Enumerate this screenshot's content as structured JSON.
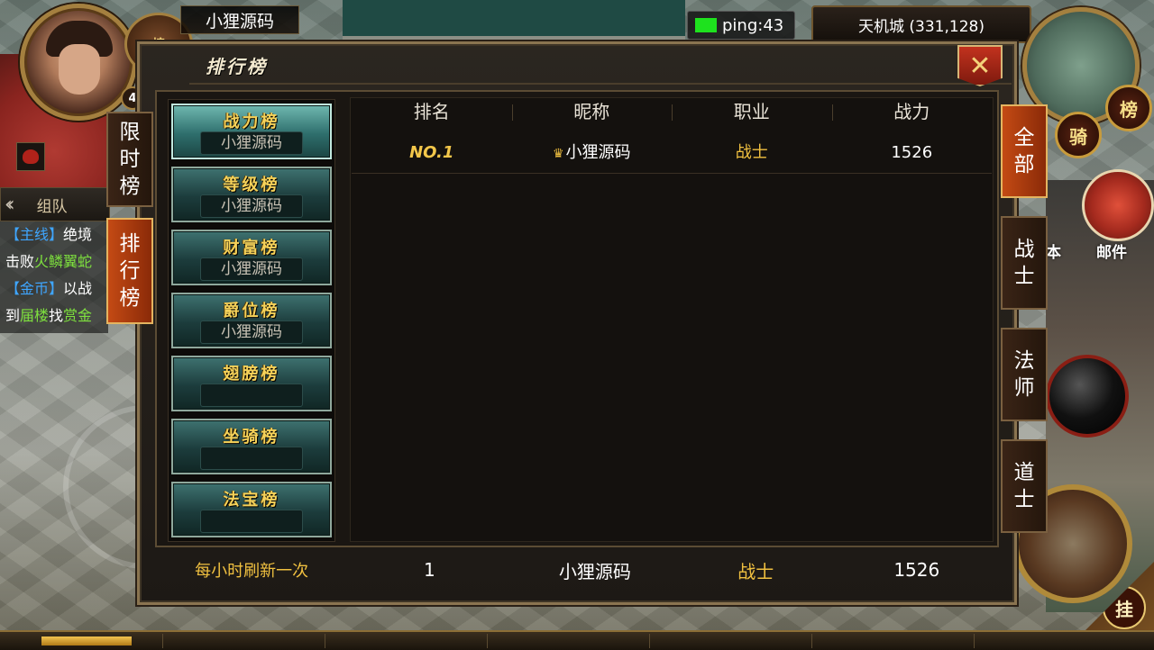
{
  "hud": {
    "player_name": "小狸源码",
    "level": "4",
    "shop_label": "榜",
    "ping_text": "ping:43",
    "location": "天机城 (331,128)",
    "ride_label": "骑",
    "rank_label": "榜",
    "mail_label": "邮件",
    "instance_label": "本",
    "hang_label": "挂",
    "colors": {
      "ping_ok": "#1ee21e",
      "accent_gold": "#f0c040",
      "active_tab": "#c44a14"
    }
  },
  "left_tabs": [
    {
      "label": "限时榜",
      "chars": [
        "限",
        "时",
        "榜"
      ],
      "active": false
    },
    {
      "label": "排行榜",
      "chars": [
        "排",
        "行",
        "榜"
      ],
      "active": true
    }
  ],
  "team": {
    "label": "组队",
    "collapse_icon": "double-chevron-left-icon"
  },
  "chat": [
    {
      "tag": "【主线】",
      "text": "绝境",
      "line2_a": "击败",
      "line2_b": "火鳞翼蛇"
    },
    {
      "tag": "【金币】",
      "text": "以战",
      "line2_a": "到",
      "line2_b": "届楼",
      "line2_c": "找",
      "line2_d": "赏金"
    }
  ],
  "window": {
    "title": "排行榜",
    "close_icon": "close-x-icon"
  },
  "categories": [
    {
      "title": "战力榜",
      "sub": "小狸源码",
      "active": true
    },
    {
      "title": "等级榜",
      "sub": "小狸源码",
      "active": false
    },
    {
      "title": "财富榜",
      "sub": "小狸源码",
      "active": false
    },
    {
      "title": "爵位榜",
      "sub": "小狸源码",
      "active": false
    },
    {
      "title": "翅膀榜",
      "sub": "",
      "active": false
    },
    {
      "title": "坐骑榜",
      "sub": "",
      "active": false
    },
    {
      "title": "法宝榜",
      "sub": "",
      "active": false
    }
  ],
  "class_tabs": [
    {
      "chars": [
        "全",
        "部"
      ],
      "active": true
    },
    {
      "chars": [
        "战",
        "士"
      ],
      "active": false
    },
    {
      "chars": [
        "法",
        "师"
      ],
      "active": false
    },
    {
      "chars": [
        "道",
        "士"
      ],
      "active": false
    }
  ],
  "table": {
    "headers": [
      "排名",
      "昵称",
      "职业",
      "战力"
    ],
    "rows": [
      {
        "rank": "NO.1",
        "crown": "♛",
        "name": "小狸源码",
        "class": "战士",
        "power": "1526"
      }
    ]
  },
  "footer": {
    "note": "每小时刷新一次",
    "rank": "1",
    "name": "小狸源码",
    "class": "战士",
    "power": "1526"
  }
}
